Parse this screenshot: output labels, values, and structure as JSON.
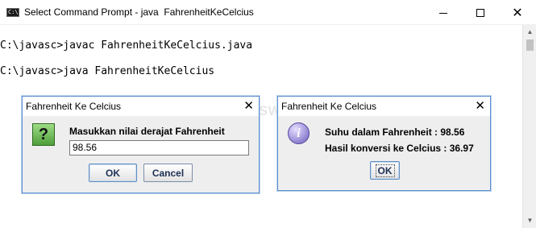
{
  "window": {
    "title": "Select Command Prompt - java  FahrenheitKeCelcius",
    "icon_label": "C:\\"
  },
  "console": {
    "lines": [
      "C:\\javasc>javac FahrenheitKeCelcius.java",
      "C:\\javasc>java FahrenheitKeCelcius"
    ]
  },
  "input_dialog": {
    "title": "Fahrenheit Ke Celcius",
    "icon": "question-icon",
    "prompt": "Masukkan nilai derajat Fahrenheit",
    "input_value": "98.56",
    "ok_label": "OK",
    "cancel_label": "Cancel"
  },
  "result_dialog": {
    "title": "Fahrenheit Ke Celcius",
    "icon": "info-icon",
    "line1": "Suhu dalam Fahrenheit : 98.56",
    "line2": "Hasil konversi ke Celcius : 36.97",
    "ok_label": "OK"
  },
  "watermark": "Termuswedia",
  "colors": {
    "dialog_border": "#5d8fcf",
    "dialog_bg": "#eeeeee",
    "button_text": "#1d2f55"
  }
}
